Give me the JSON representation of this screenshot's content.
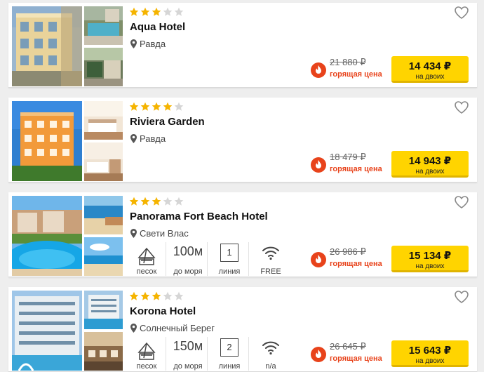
{
  "currency_note": "₽",
  "hotels": [
    {
      "name": "Aqua Hotel",
      "stars": 3,
      "location": "Равда",
      "old_price": "21 880 ₽",
      "hot_label": "горящая цена",
      "price": "14 434 ₽",
      "price_note": "на двоих",
      "features": null
    },
    {
      "name": "Riviera Garden",
      "stars": 4,
      "location": "Равда",
      "old_price": "18 479 ₽",
      "hot_label": "горящая цена",
      "price": "14 943 ₽",
      "price_note": "на двоих",
      "features": null
    },
    {
      "name": "Panorama Fort Beach Hotel",
      "stars": 3,
      "location": "Свети Влас",
      "old_price": "26 986 ₽",
      "hot_label": "горящая цена",
      "price": "15 134 ₽",
      "price_note": "на двоих",
      "features": {
        "beach": "песок",
        "distance": "100м",
        "distance_label": "до моря",
        "line": "1",
        "line_label": "линия",
        "wifi": "FREE"
      }
    },
    {
      "name": "Korona Hotel",
      "stars": 3,
      "location": "Солнечный Берег",
      "old_price": "26 645 ₽",
      "hot_label": "горящая цена",
      "price": "15 643 ₽",
      "price_note": "на двоих",
      "features": {
        "beach": "песок",
        "distance": "150м",
        "distance_label": "до моря",
        "line": "2",
        "line_label": "линия",
        "wifi": "n/a"
      }
    }
  ],
  "colors": {
    "star_on": "#f5b400",
    "star_off": "#d6d6d6",
    "hot": "#e8431b",
    "button": "#ffd400"
  }
}
